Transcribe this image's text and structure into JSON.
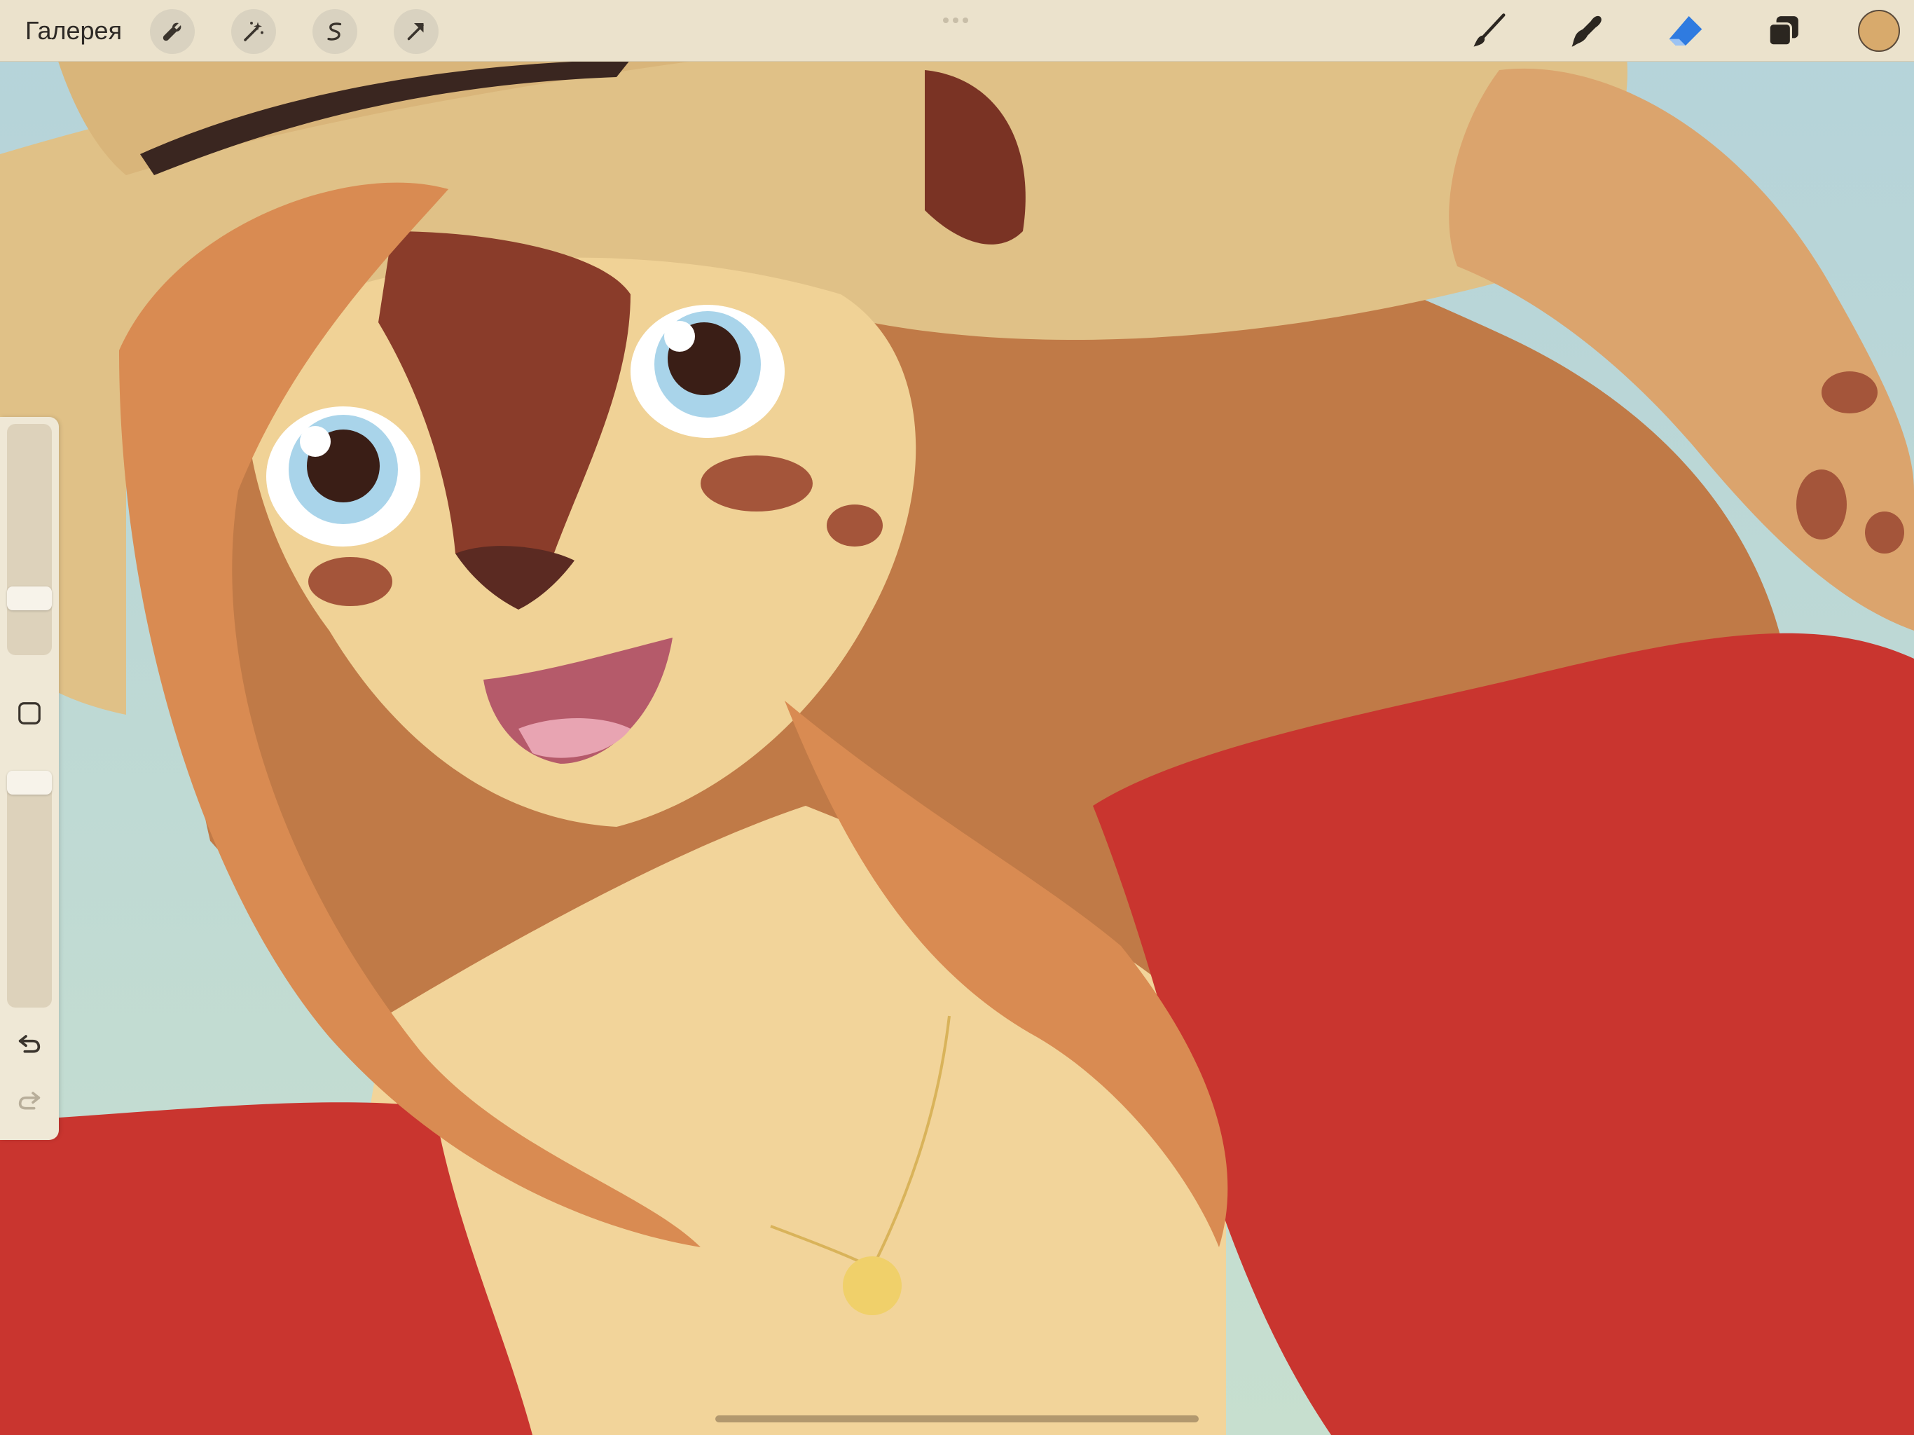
{
  "topbar": {
    "gallery_label": "Галерея",
    "left_tools": [
      {
        "id": "actions",
        "icon": "wrench-icon"
      },
      {
        "id": "adjustments",
        "icon": "magic-wand-icon"
      },
      {
        "id": "selection",
        "icon": "selection-s-icon"
      },
      {
        "id": "transform",
        "icon": "arrow-cursor-icon"
      }
    ],
    "right_tools": [
      {
        "id": "brush",
        "icon": "brush-icon"
      },
      {
        "id": "smudge",
        "icon": "smudge-icon"
      },
      {
        "id": "eraser",
        "icon": "eraser-icon",
        "active": true
      },
      {
        "id": "layers",
        "icon": "layers-icon"
      }
    ],
    "current_color": "#d8aa6c",
    "accent_color": "#2f7be0"
  },
  "sidebar": {
    "brush_size_level": 0.28,
    "opacity_level": 0.06,
    "modify_icon": "square-icon",
    "undo_icon": "undo-icon",
    "redo_icon": "redo-icon"
  },
  "canvas": {
    "colors": {
      "sky": "#bfd9d6",
      "hat": "#e2c28a",
      "hat_band": "#3a2620",
      "hair": "#c47a44",
      "fur": "#f2d49a",
      "muzzle_dark": "#7c3a2a",
      "shirt": "#c9352f",
      "eye": "#a9d4ea"
    }
  }
}
